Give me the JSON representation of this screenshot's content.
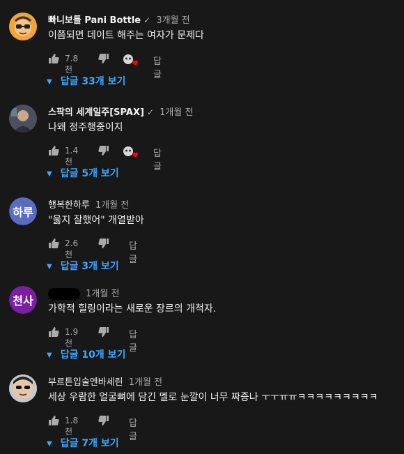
{
  "comments": [
    {
      "author": "빠니보틀 Pani Bottle",
      "verified": true,
      "time": "3개월 전",
      "text": "이쯤되면 데이트 해주는 여자가 문제다",
      "likes": "7.8천",
      "reply_label": "답글",
      "replies_label": "답글 33개 보기",
      "creator_heart": true,
      "avatar": {
        "kind": "image",
        "icon": "cartoon-face-avatar"
      }
    },
    {
      "author": "스팍의 세계일주[SPAX]",
      "verified": true,
      "time": "1개월 전",
      "text": "나왜 정주행중이지",
      "likes": "1.4천",
      "reply_label": "답글",
      "replies_label": "답글 5개 보기",
      "creator_heart": true,
      "avatar": {
        "kind": "image",
        "icon": "person-photo-avatar"
      }
    },
    {
      "author": "행복한하루",
      "verified": false,
      "time": "1개월 전",
      "text": "\"욿지 잘했어\" 개열받아",
      "likes": "2.6천",
      "reply_label": "답글",
      "replies_label": "답글 3개 보기",
      "creator_heart": false,
      "avatar": {
        "kind": "letters",
        "letters": "하루",
        "color": "#5c6bc0"
      }
    },
    {
      "author": "",
      "verified": false,
      "time": "1개월 전",
      "text": "가학적 힐링이라는 새로운 장르의 개척자.",
      "likes": "1.9천",
      "reply_label": "답글",
      "replies_label": "답글 10개 보기",
      "creator_heart": false,
      "avatar": {
        "kind": "letters",
        "letters": "천사",
        "color": "#7b1fa2"
      }
    },
    {
      "author": "부르튼입술엔바세린",
      "verified": false,
      "time": "1개월 전",
      "text": "세상 우람한 얼굴뼈에 담긴 멜로 눈깔이 너무 짜증나 ㅜㅜㅠㅠㅋㅋㅋㅋㅋㅋㅋㅋㅋ",
      "likes": "1.8천",
      "reply_label": "답글",
      "replies_label": "답글 7개 보기",
      "creator_heart": false,
      "avatar": {
        "kind": "image",
        "icon": "sunglasses-face-avatar"
      }
    }
  ]
}
